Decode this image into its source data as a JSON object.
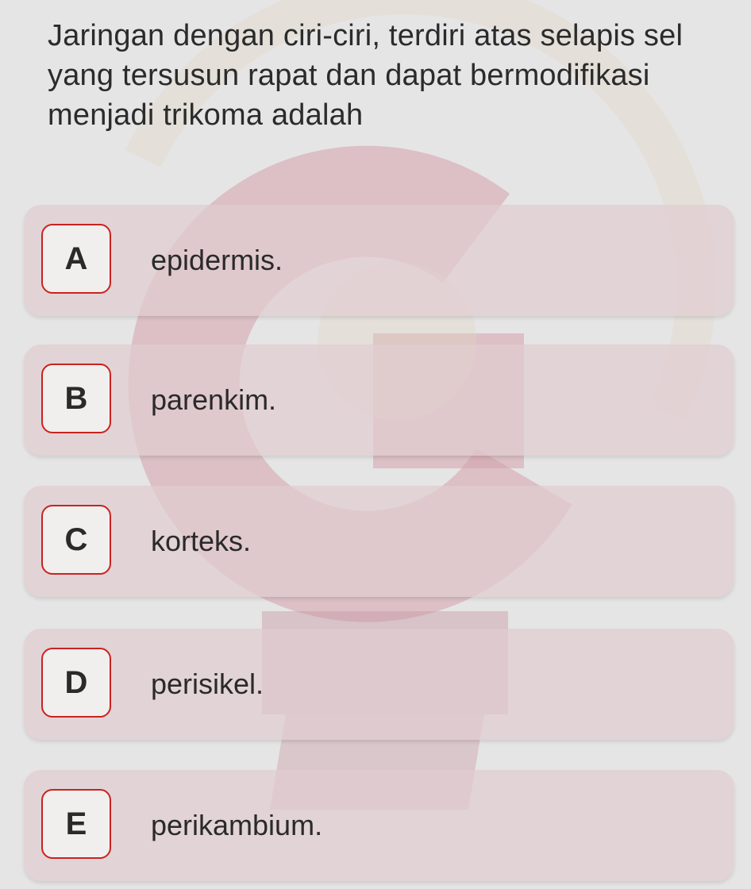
{
  "question": {
    "text": "Jaringan dengan ciri-ciri, terdiri atas selapis sel yang tersusun rapat dan dapat bermodifikasi menjadi trikoma adalah"
  },
  "options": [
    {
      "letter": "A",
      "text": "epidermis."
    },
    {
      "letter": "B",
      "text": "parenkim."
    },
    {
      "letter": "C",
      "text": "korteks."
    },
    {
      "letter": "D",
      "text": "perisikel."
    },
    {
      "letter": "E",
      "text": "perikambium."
    }
  ],
  "colors": {
    "background": "#e6e5e6",
    "option_fill": "#e0ccd0",
    "letter_border": "#c9231f",
    "text": "#2b2b2b"
  }
}
